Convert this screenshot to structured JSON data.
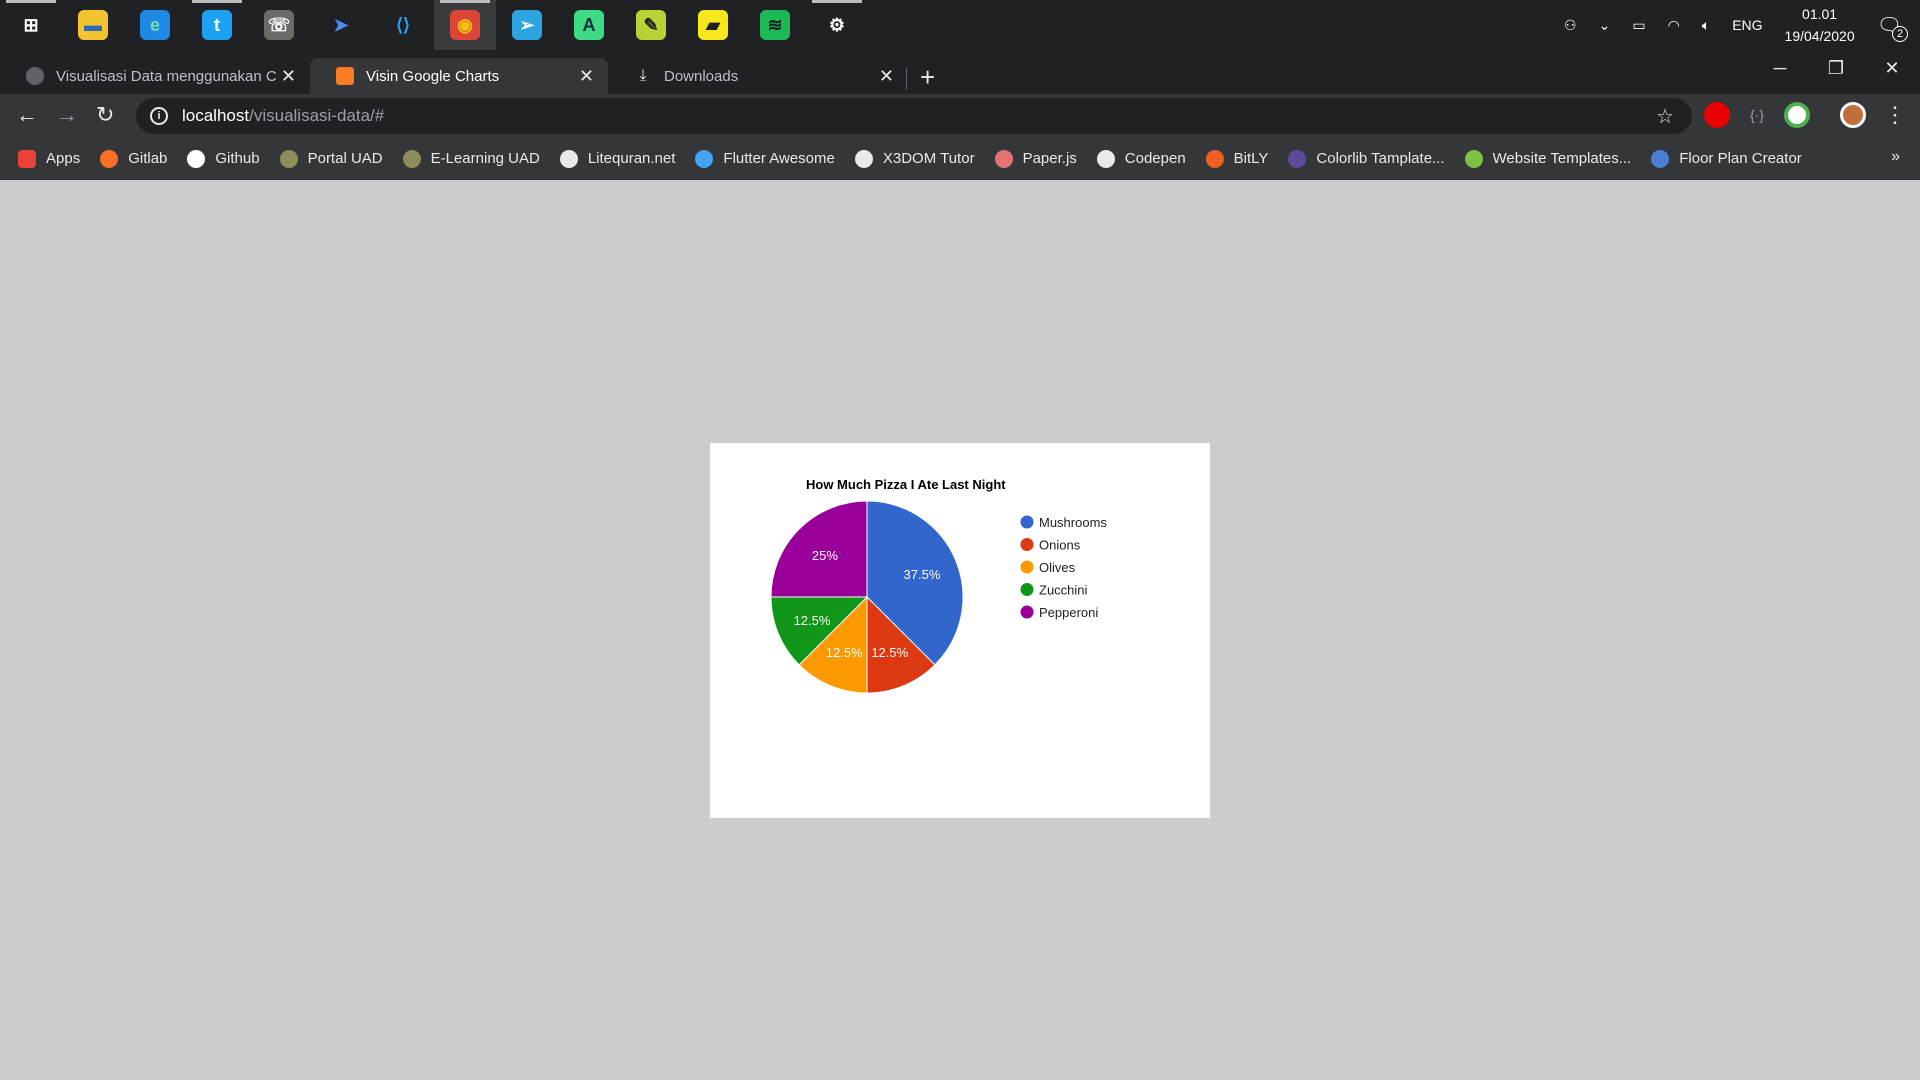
{
  "taskbar": {
    "apps": [
      {
        "name": "windows-start-icon",
        "glyph": "⊞",
        "color": "#202124",
        "fg": "#ffffff"
      },
      {
        "name": "file-explorer-icon",
        "glyph": "▬",
        "color": "#f4c430",
        "fg": "#2b6cb0"
      },
      {
        "name": "edge-icon",
        "glyph": "e",
        "color": "#1e88e5",
        "fg": "#7ee0a0"
      },
      {
        "name": "twitter-icon",
        "glyph": "t",
        "color": "#1da1f2",
        "fg": "#ffffff"
      },
      {
        "name": "whatsapp-icon",
        "glyph": "☏",
        "color": "#6b6b6b",
        "fg": "#ffffff"
      },
      {
        "name": "dolphin-icon",
        "glyph": "➤",
        "color": "#202124",
        "fg": "#4a8df0"
      },
      {
        "name": "vscode-icon",
        "glyph": "⟨⟩",
        "color": "#202124",
        "fg": "#2ea0f5"
      },
      {
        "name": "chrome-icon",
        "glyph": "◉",
        "color": "#db4437",
        "fg": "#f4c20d"
      },
      {
        "name": "telegram-icon",
        "glyph": "➢",
        "color": "#2ca5e0",
        "fg": "#ffffff"
      },
      {
        "name": "android-studio-icon",
        "glyph": "A",
        "color": "#3ddc84",
        "fg": "#073042"
      },
      {
        "name": "inkscape-icon",
        "glyph": "✎",
        "color": "#b5d334",
        "fg": "#202124"
      },
      {
        "name": "sticky-notes-icon",
        "glyph": "▰",
        "color": "#f8e71c",
        "fg": "#202124"
      },
      {
        "name": "spotify-icon",
        "glyph": "≋",
        "color": "#1db954",
        "fg": "#202124"
      },
      {
        "name": "settings-gear-icon",
        "glyph": "⚙",
        "color": "#202124",
        "fg": "#ffffff"
      }
    ],
    "underlined": [
      0,
      3,
      7,
      13
    ],
    "active_index": 7,
    "tray": {
      "language": "ENG",
      "time": "01.01",
      "date": "19/04/2020",
      "notifications": "2"
    }
  },
  "tabs": [
    {
      "title": "Visualisasi Data menggunakan C",
      "fav_color": "#5f6368"
    },
    {
      "title": "Visin Google Charts",
      "fav_color": "#fb7a24"
    },
    {
      "title": "Downloads",
      "fav_color": "#35363a"
    }
  ],
  "active_tab": 1,
  "address": {
    "host": "localhost",
    "path": "/visualisasi-data/#"
  },
  "bookmarks": [
    {
      "label": "Apps",
      "color": "#ea4335"
    },
    {
      "label": "Gitlab",
      "color": "#fc6d26"
    },
    {
      "label": "Github",
      "color": "#ffffff"
    },
    {
      "label": "Portal UAD",
      "color": "#8d8d5a"
    },
    {
      "label": "E-Learning UAD",
      "color": "#8d8d5a"
    },
    {
      "label": "Litequran.net",
      "color": "#e8eaed"
    },
    {
      "label": "Flutter Awesome",
      "color": "#42a5f5"
    },
    {
      "label": "X3DOM Tutor",
      "color": "#e8eaed"
    },
    {
      "label": "Paper.js",
      "color": "#e57373"
    },
    {
      "label": "Codepen",
      "color": "#e8eaed"
    },
    {
      "label": "BitLY",
      "color": "#ee6123"
    },
    {
      "label": "Colorlib Tamplate...",
      "color": "#5c4a9c"
    },
    {
      "label": "Website Templates...",
      "color": "#7cc142"
    },
    {
      "label": "Floor Plan Creator",
      "color": "#4a7fd4"
    }
  ],
  "chart_data": {
    "type": "pie",
    "title": "How Much Pizza I Ate Last Night",
    "categories": [
      "Mushrooms",
      "Onions",
      "Olives",
      "Zucchini",
      "Pepperoni"
    ],
    "values": [
      3,
      1,
      1,
      1,
      2
    ],
    "labels": [
      "37.5%",
      "12.5%",
      "12.5%",
      "12.5%",
      "25%"
    ],
    "colors": [
      "#3366cc",
      "#dc3912",
      "#ff9900",
      "#109618",
      "#990099"
    ],
    "legend_position": "right"
  }
}
